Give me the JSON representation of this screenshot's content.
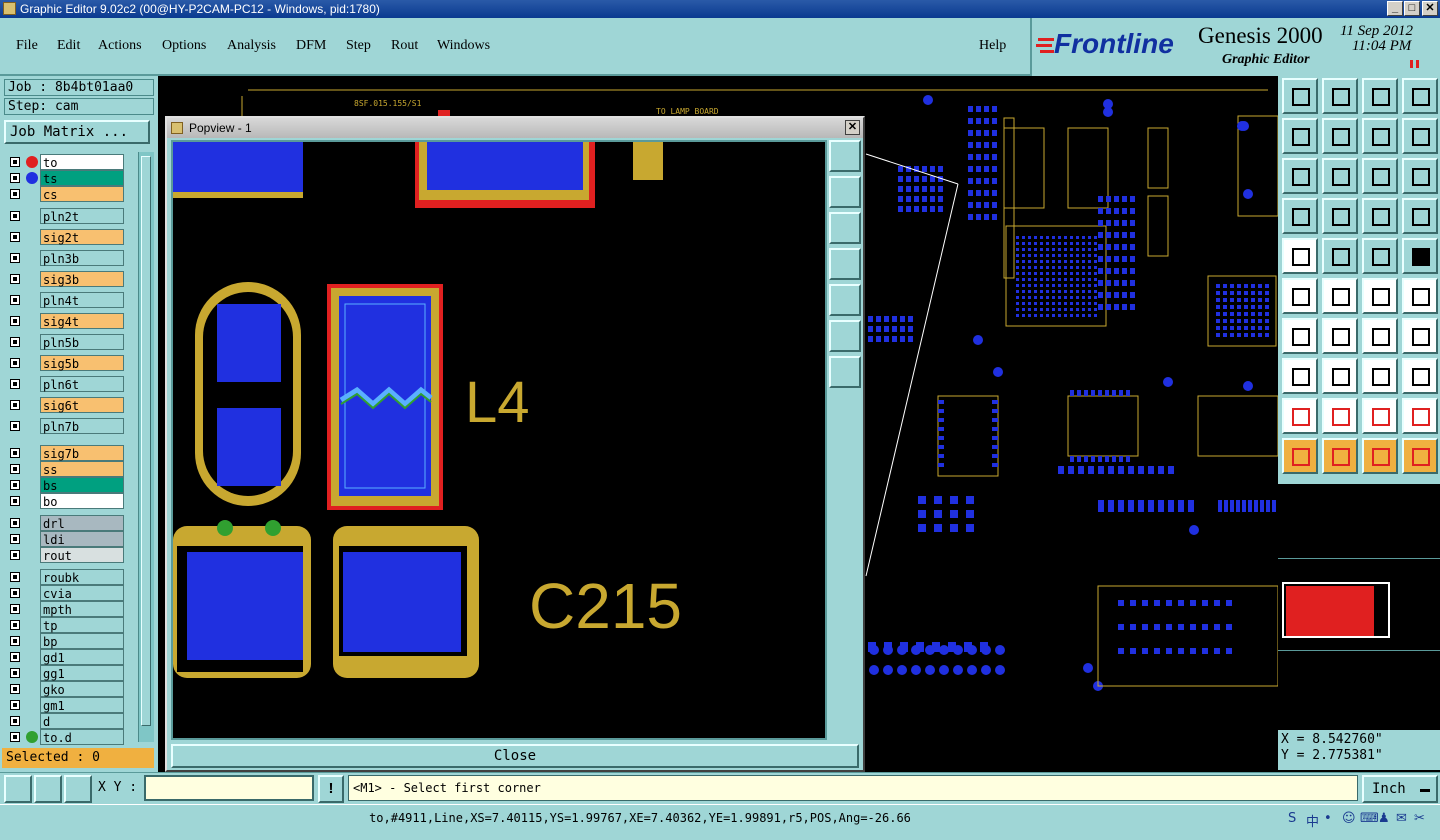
{
  "window": {
    "title": "Graphic Editor 9.02c2 (00@HY-P2CAM-PC12 - Windows, pid:1780)",
    "minimize": "_",
    "maximize": "□",
    "close": "✕"
  },
  "menu": [
    "File",
    "Edit",
    "Actions",
    "Options",
    "Analysis",
    "DFM",
    "Step",
    "Rout",
    "Windows"
  ],
  "help_label": "Help",
  "brand": {
    "logo": "Frontline",
    "product": "Genesis 2000",
    "subtitle": "Graphic Editor",
    "date": "11 Sep 2012",
    "time": "11:04 PM"
  },
  "left": {
    "job": "Job : 8b4bt01aa0",
    "step": "Step: cam",
    "job_matrix": "Job Matrix ...",
    "selected": "Selected : 0",
    "layers": [
      {
        "name": "to",
        "bg": "#ffffff",
        "dot": "#e02020"
      },
      {
        "name": "ts",
        "bg": "#00a080",
        "dot": "#2030e0"
      },
      {
        "name": "cs",
        "bg": "#f8c070",
        "dot": ""
      },
      {
        "name": "pln2t",
        "bg": "#9fd6d6",
        "dot": ""
      },
      {
        "name": "sig2t",
        "bg": "#f8c070",
        "dot": ""
      },
      {
        "name": "pln3b",
        "bg": "#9fd6d6",
        "dot": ""
      },
      {
        "name": "sig3b",
        "bg": "#f8c070",
        "dot": ""
      },
      {
        "name": "pln4t",
        "bg": "#9fd6d6",
        "dot": ""
      },
      {
        "name": "sig4t",
        "bg": "#f8c070",
        "dot": ""
      },
      {
        "name": "pln5b",
        "bg": "#9fd6d6",
        "dot": ""
      },
      {
        "name": "sig5b",
        "bg": "#f8c070",
        "dot": ""
      },
      {
        "name": "pln6t",
        "bg": "#9fd6d6",
        "dot": ""
      },
      {
        "name": "sig6t",
        "bg": "#f8c070",
        "dot": ""
      },
      {
        "name": "pln7b",
        "bg": "#9fd6d6",
        "dot": ""
      },
      {
        "name": "sig7b",
        "bg": "#f8c070",
        "dot": ""
      },
      {
        "name": "ss",
        "bg": "#f8c070",
        "dot": ""
      },
      {
        "name": "bs",
        "bg": "#00a080",
        "dot": ""
      },
      {
        "name": "bo",
        "bg": "#ffffff",
        "dot": ""
      },
      {
        "name": "drl",
        "bg": "#a8b8c0",
        "dot": ""
      },
      {
        "name": "ldi",
        "bg": "#a8b8c0",
        "dot": ""
      },
      {
        "name": "rout",
        "bg": "#d8e0e0",
        "dot": ""
      },
      {
        "name": "roubk",
        "bg": "#9fd6d6",
        "dot": ""
      },
      {
        "name": "cvia",
        "bg": "#9fd6d6",
        "dot": ""
      },
      {
        "name": "mpth",
        "bg": "#9fd6d6",
        "dot": ""
      },
      {
        "name": "tp",
        "bg": "#9fd6d6",
        "dot": ""
      },
      {
        "name": "bp",
        "bg": "#9fd6d6",
        "dot": ""
      },
      {
        "name": "gd1",
        "bg": "#9fd6d6",
        "dot": ""
      },
      {
        "name": "gg1",
        "bg": "#9fd6d6",
        "dot": ""
      },
      {
        "name": "gko",
        "bg": "#9fd6d6",
        "dot": ""
      },
      {
        "name": "gm1",
        "bg": "#9fd6d6",
        "dot": ""
      },
      {
        "name": "d",
        "bg": "#9fd6d6",
        "dot": ""
      },
      {
        "name": "to.d",
        "bg": "#9fd6d6",
        "dot": "#30a030"
      }
    ]
  },
  "board_labels": {
    "part": "8SF.015.155/S1",
    "lamp": "TO LAMP BOARD"
  },
  "popview": {
    "title": "Popview - 1",
    "label_l4": "L4",
    "label_c215": "C215",
    "close_label": "Close"
  },
  "coords": {
    "x": "X = 8.542760\"",
    "y": "Y = 2.775381\""
  },
  "bottom": {
    "xy_label": "X Y :",
    "xy_value": "",
    "prompt": "<M1> - Select first corner",
    "units": "Inch"
  },
  "status": "to,#4911,Line,XS=7.40115,YS=1.99767,XE=7.40362,YE=1.99891,r5,POS,Ang=-26.66",
  "tray": [
    "S",
    "中",
    "•",
    "☺",
    "⌨",
    "♟",
    "✉",
    "✂"
  ]
}
